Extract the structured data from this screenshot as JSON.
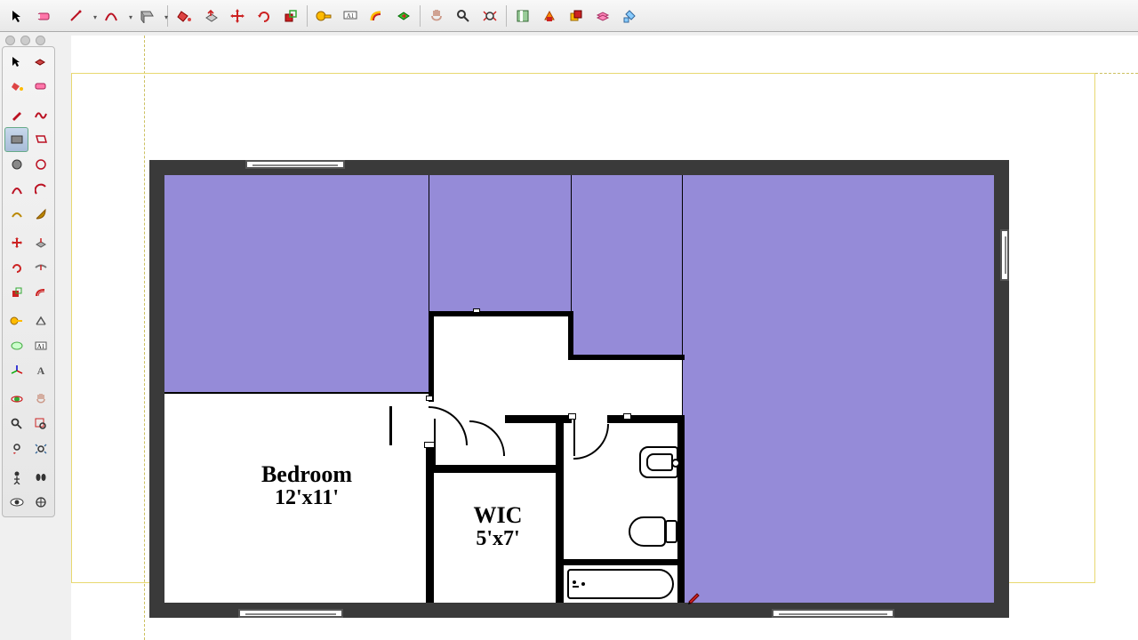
{
  "app": {
    "name": "sketchup-floorplan"
  },
  "rooms": {
    "bedroom": {
      "title": "Bedroom",
      "dim": "12'x11'"
    },
    "wic": {
      "title": "WIC",
      "dim": "5'x7'"
    }
  },
  "fill_color": "#958bd8",
  "toolbar_top": [
    "select-tool",
    "eraser-tool",
    "line-tool",
    "arc-tool",
    "rectangle-tool",
    "paint-bucket-tool",
    "push-pull-tool",
    "move-tool",
    "rotate-tool",
    "scale-tool",
    "tape-measure-tool",
    "dimension-tool",
    "text-tool",
    "offset-tool",
    "follow-me-tool",
    "orbit-tool",
    "pan-tool",
    "zoom-tool",
    "zoom-extents-tool",
    "section-plane-tool",
    "outliner-tool",
    "components-tool",
    "layers-tool",
    "styles-tool"
  ],
  "toolbar_side": [
    [
      "select-icon",
      "component-icon"
    ],
    [
      "paint-icon",
      "eraser-icon"
    ],
    [
      "",
      ""
    ],
    [
      "pencil-icon",
      "freehand-icon"
    ],
    [
      "rectangle-icon",
      "rotated-rect-icon"
    ],
    [
      "circle-icon",
      "polygon-icon"
    ],
    [
      "arc-icon",
      "2pt-arc-icon"
    ],
    [
      "3pt-arc-icon",
      "pie-icon"
    ],
    [
      "",
      ""
    ],
    [
      "move-icon",
      "pushpull-icon"
    ],
    [
      "rotate-icon",
      "followme-icon"
    ],
    [
      "scale-icon",
      "offset-icon"
    ],
    [
      "",
      ""
    ],
    [
      "tape-icon",
      "protractor-icon"
    ],
    [
      "dimension-icon",
      "text-icon"
    ],
    [
      "axes-icon",
      "3dtext-icon"
    ],
    [
      "",
      ""
    ],
    [
      "orbit-icon",
      "pan-icon"
    ],
    [
      "zoom-icon",
      "zoom-window-icon"
    ],
    [
      "zoom-extents-icon",
      "prev-view-icon"
    ],
    [
      "",
      ""
    ],
    [
      "position-camera-icon",
      "walk-icon"
    ],
    [
      "look-around-icon",
      "section-icon"
    ]
  ]
}
